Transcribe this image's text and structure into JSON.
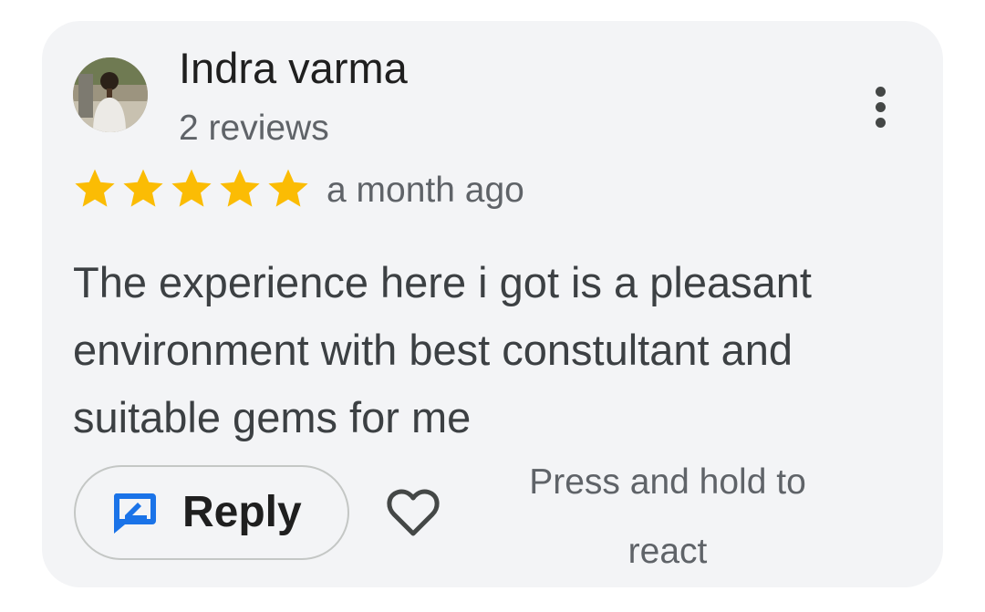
{
  "review": {
    "author_name": "Indra varma",
    "author_reviews": "2 reviews",
    "rating": 5,
    "rating_max": 5,
    "time_ago": "a month ago",
    "text": "The experience here i got is a pleasant environment with best constultant and suitable gems for me"
  },
  "actions": {
    "reply_label": "Reply",
    "react_hint": "Press and hold to react"
  },
  "icons": {
    "avatar": "avatar",
    "more": "more-vert-icon",
    "star": "star-icon",
    "reply": "reply-icon",
    "heart": "heart-outline-icon"
  },
  "colors": {
    "star": "#FBBC04",
    "reply_icon": "#1A73E8",
    "card_bg": "#F3F4F6"
  }
}
